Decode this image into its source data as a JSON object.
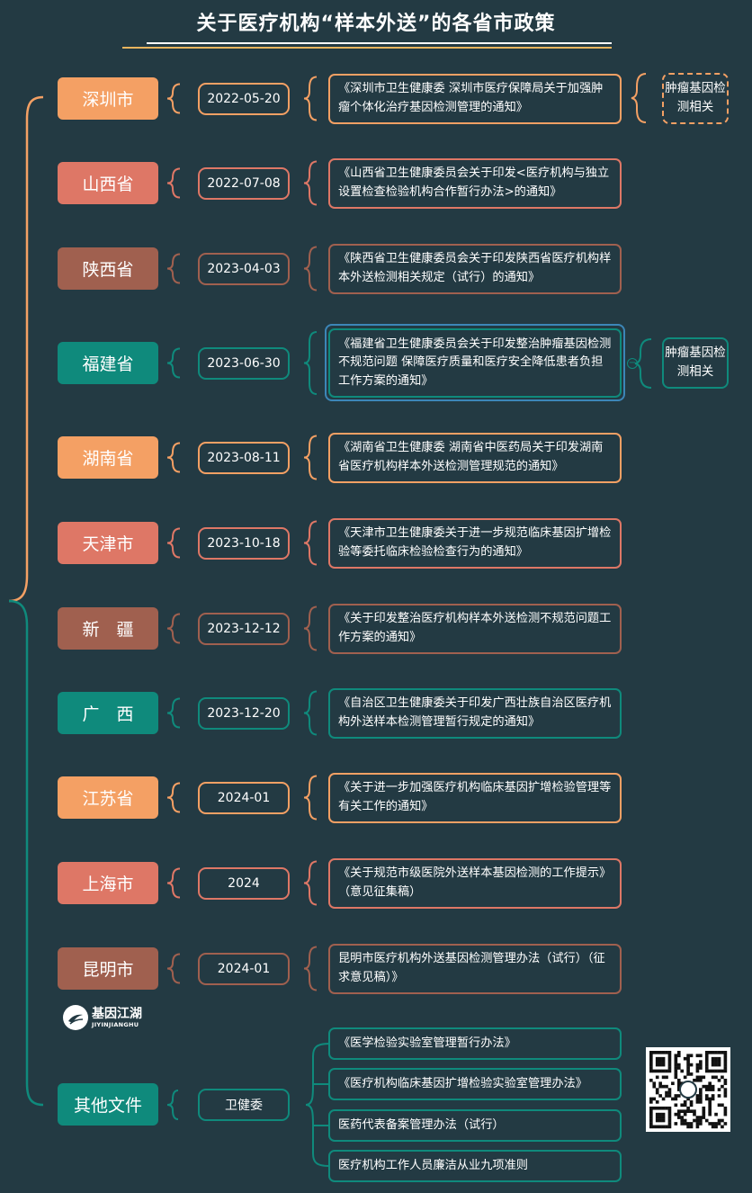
{
  "title": "关于医疗机构“样本外送”的各省市政策",
  "colors": {
    "background": "#233a43",
    "orange": "#f4a064",
    "red": "#de7766",
    "brown": "#a0604f",
    "teal": "#0f8a7c",
    "accent_line": "#e8b45e"
  },
  "rows": [
    {
      "region": "深圳市",
      "date": "2022-05-20",
      "doc": "《深圳市卫生健康委 深圳市医疗保障局关于加强肿瘤个体化治疗基因检测管理的通知》",
      "tag": "肿瘤基因检测相关"
    },
    {
      "region": "山西省",
      "date": "2022-07-08",
      "doc": "《山西省卫生健康委员会关于印发<医疗机构与独立设置检查检验机构合作暂行办法>的通知》"
    },
    {
      "region": "陕西省",
      "date": "2023-04-03",
      "doc": "《陕西省卫生健康委员会关于印发陕西省医疗机构样本外送检测相关规定（试行）的通知》"
    },
    {
      "region": "福建省",
      "date": "2023-06-30",
      "doc": "《福建省卫生健康委员会关于印发整治肿瘤基因检测不规范问题 保障医疗质量和医疗安全降低患者负担工作方案的通知》",
      "tag": "肿瘤基因检测相关"
    },
    {
      "region": "湖南省",
      "date": "2023-08-11",
      "doc": "《湖南省卫生健康委 湖南省中医药局关于印发湖南省医疗机构样本外送检测管理规范的通知》"
    },
    {
      "region": "天津市",
      "date": "2023-10-18",
      "doc": "《天津市卫生健康委关于进一步规范临床基因扩增检验等委托临床检验检查行为的通知》"
    },
    {
      "region": "新　疆",
      "date": "2023-12-12",
      "doc": "《关于印发整治医疗机构样本外送检测不规范问题工作方案的通知》"
    },
    {
      "region": "广　西",
      "date": "2023-12-20",
      "doc": "《自治区卫生健康委关于印发广西壮族自治区医疗机构外送样本检测管理暂行规定的通知》"
    },
    {
      "region": "江苏省",
      "date": "2024-01",
      "doc": "《关于进一步加强医疗机构临床基因扩增检验管理等有关工作的通知》"
    },
    {
      "region": "上海市",
      "date": "2024",
      "doc": "《关于规范市级医院外送样本基因检测的工作提示》（意见征集稿）"
    },
    {
      "region": "昆明市",
      "date": "2024-01",
      "doc": "昆明市医疗机构外送基因检测管理办法（试行）（征求意见稿）》"
    }
  ],
  "other": {
    "region": "其他文件",
    "issuer": "卫健委",
    "docs": [
      "《医学检验实验室管理暂行办法》",
      "《医疗机构临床基因扩增检验实验室管理办法》",
      "医药代表备案管理办法（试行）",
      "医疗机构工作人员廉洁从业九项准则"
    ]
  },
  "logo": {
    "cn": "基因江湖",
    "en": "JIYINJIANGHU"
  },
  "qr_icon": "qr-code-icon"
}
